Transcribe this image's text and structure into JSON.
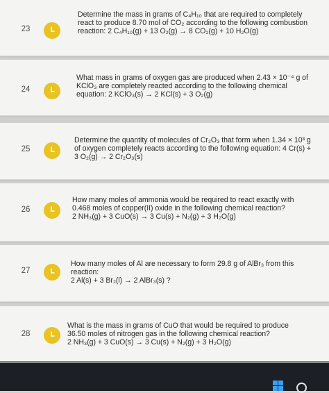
{
  "questions": [
    {
      "number": "23",
      "lines": [
        "Determine the mass in grams of C₄H₁₀ that are required to completely",
        "react to produce 8.70 mol of CO₂ according to the following combustion",
        "reaction: 2 C₄H₁₀(g) + 13 O₂(g) → 8 CO₂(g) + 10 H₂O(g)"
      ]
    },
    {
      "number": "24",
      "lines": [
        "What mass in grams of oxygen gas are produced when 2.43 × 10⁻⁴ g of",
        "KClO₃ are completely reacted according to the following chemical",
        "equation: 2 KClO₃(s) → 2 KCl(s) + 3 O₂(g)"
      ]
    },
    {
      "number": "25",
      "lines": [
        "Determine the quantity of molecules of Cr₂O₃ that form when 1.34 × 10³ g",
        "of oxygen completely reacts according to the following equation: 4 Cr(s) +",
        "3 O₂(g) → 2 Cr₂O₃(s)"
      ]
    },
    {
      "number": "26",
      "lines": [
        "How many moles of ammonia would be required to react exactly with",
        "0.468 moles of copper(II) oxide in the following chemical reaction?",
        "2 NH₃(g) + 3 CuO(s) → 3 Cu(s) + N₂(g) + 3 H₂O(g)"
      ]
    },
    {
      "number": "27",
      "lines": [
        "How many moles of Al are necessary to form 29.8 g of AlBr₃ from this",
        "reaction:",
        "2 Al(s) + 3 Br₂(l) → 2 AlBr₃(s) ?"
      ]
    },
    {
      "number": "28",
      "lines": [
        "What is the mass in grams of CuO that would be required to produce",
        "36.50 moles of nitrogen gas in the following chemical reaction?",
        "2 NH₃(g) + 3 CuO(s) → 3 Cu(s) + N₂(g) + 3 H₂O(g)"
      ]
    }
  ],
  "icons": {
    "question_status": "clock-icon",
    "start": "windows-start-icon",
    "search": "search-icon"
  },
  "colors": {
    "status_icon": "#e8c321",
    "card_background": "#f4f4f2",
    "taskbar": "#1c1f26",
    "windows_logo": "#3aa0f0"
  }
}
